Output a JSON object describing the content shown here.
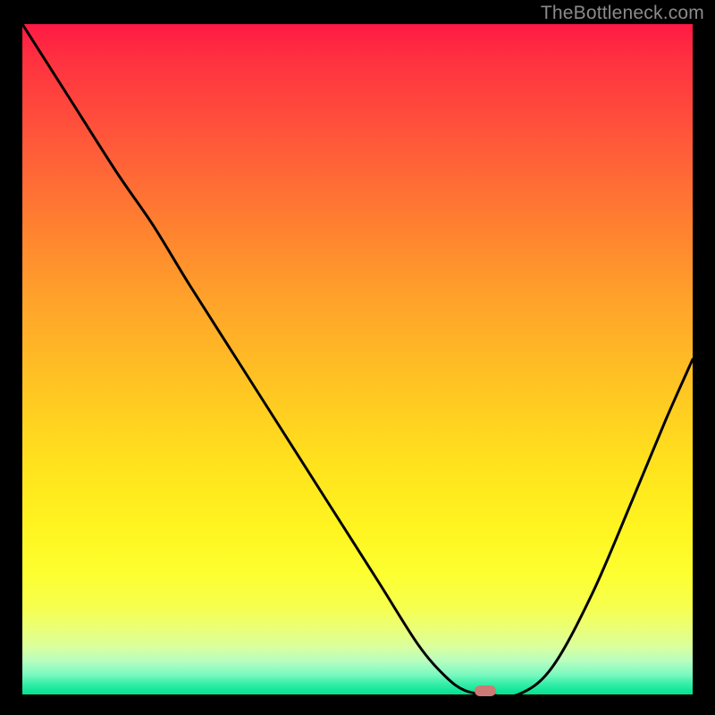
{
  "watermark": "TheBottleneck.com",
  "chart_data": {
    "type": "line",
    "title": "",
    "xlabel": "",
    "ylabel": "",
    "x_range": [
      0,
      1
    ],
    "y_range": [
      0,
      1
    ],
    "series": [
      {
        "name": "curve",
        "x": [
          0.0,
          0.07,
          0.14,
          0.195,
          0.25,
          0.32,
          0.39,
          0.46,
          0.53,
          0.59,
          0.63,
          0.66,
          0.695,
          0.74,
          0.79,
          0.85,
          0.91,
          0.96,
          1.0
        ],
        "y": [
          1.0,
          0.89,
          0.78,
          0.7,
          0.61,
          0.5,
          0.39,
          0.28,
          0.17,
          0.075,
          0.028,
          0.006,
          0.0,
          0.0,
          0.04,
          0.15,
          0.29,
          0.41,
          0.5
        ]
      }
    ],
    "marker": {
      "x": 0.69,
      "y": 0.0
    },
    "gradient": [
      {
        "pos": 0.0,
        "color": "#ff1a44"
      },
      {
        "pos": 0.3,
        "color": "#ff8030"
      },
      {
        "pos": 0.55,
        "color": "#ffc722"
      },
      {
        "pos": 0.82,
        "color": "#fdff30"
      },
      {
        "pos": 1.0,
        "color": "#00e28f"
      }
    ]
  }
}
